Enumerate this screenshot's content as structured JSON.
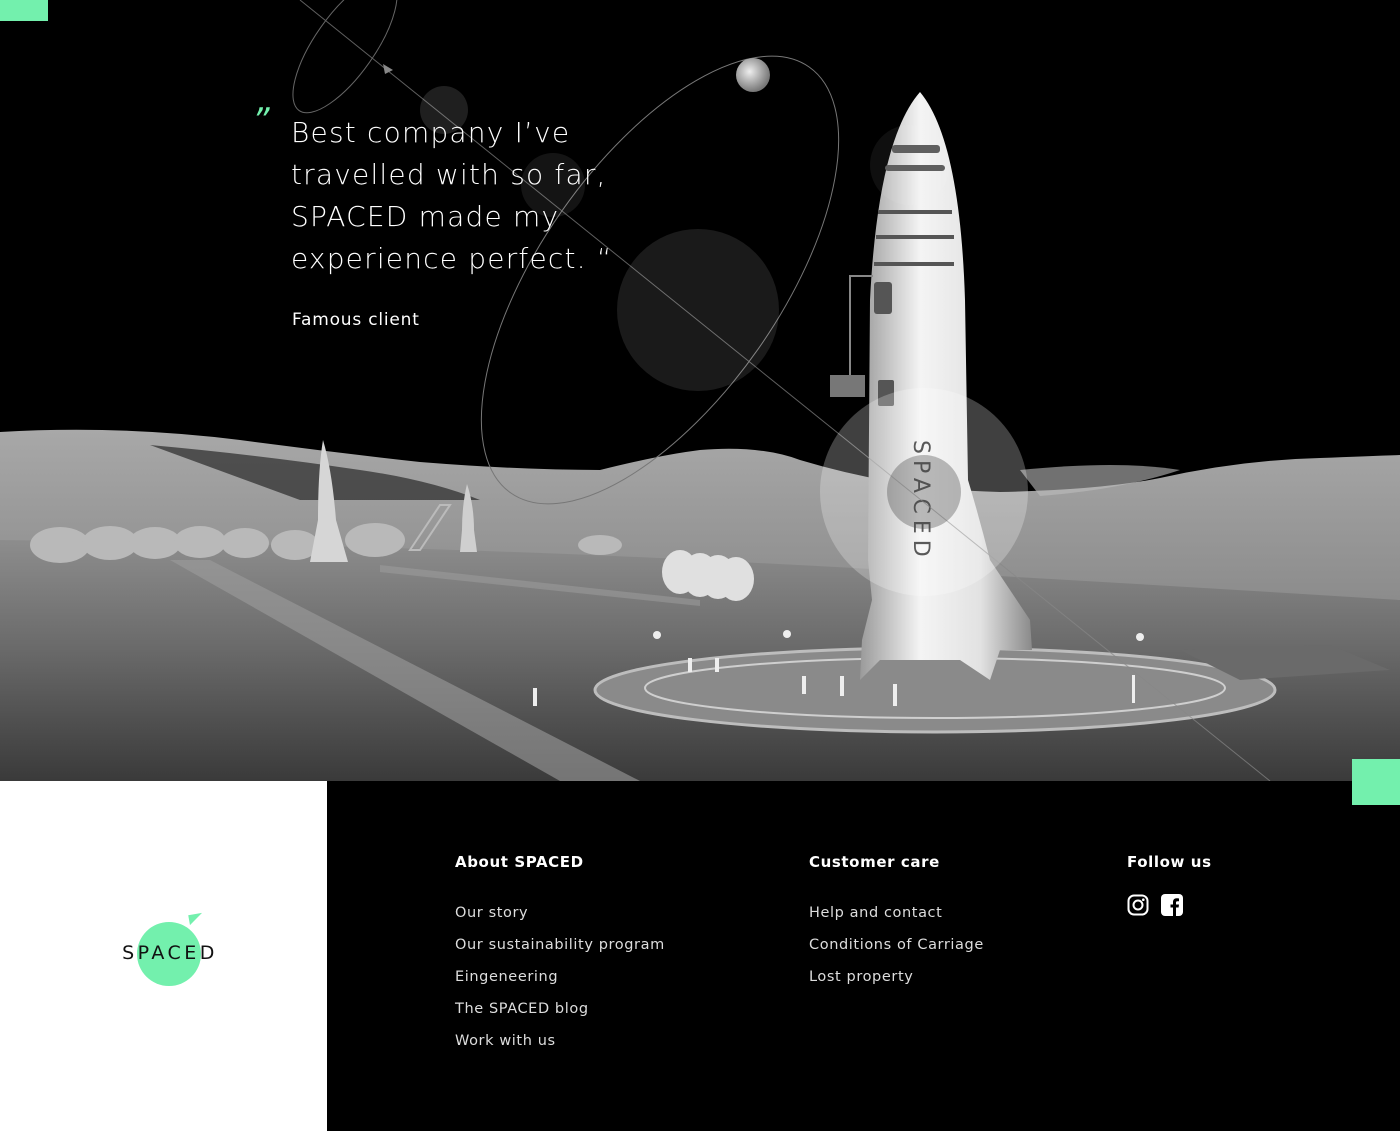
{
  "hero": {
    "quote_mark": "”",
    "quote": "Best company I’ve travelled with so far, SPACED made my experience perfect. “",
    "author": "Famous client",
    "rocket_brand": "SPACED"
  },
  "logo": {
    "text": "SPACED"
  },
  "footer": {
    "about": {
      "title": "About SPACED",
      "links": [
        "Our story",
        "Our sustainability program",
        "Eingeneering",
        "The SPACED blog",
        "Work with us"
      ]
    },
    "care": {
      "title": "Customer care",
      "links": [
        "Help and contact",
        "Conditions of Carriage",
        "Lost property"
      ]
    },
    "follow": {
      "title": "Follow us",
      "icons": [
        "instagram-icon",
        "facebook-icon"
      ]
    }
  },
  "colors": {
    "accent": "#73f0ad",
    "background": "#000000",
    "panel": "#ffffff"
  }
}
